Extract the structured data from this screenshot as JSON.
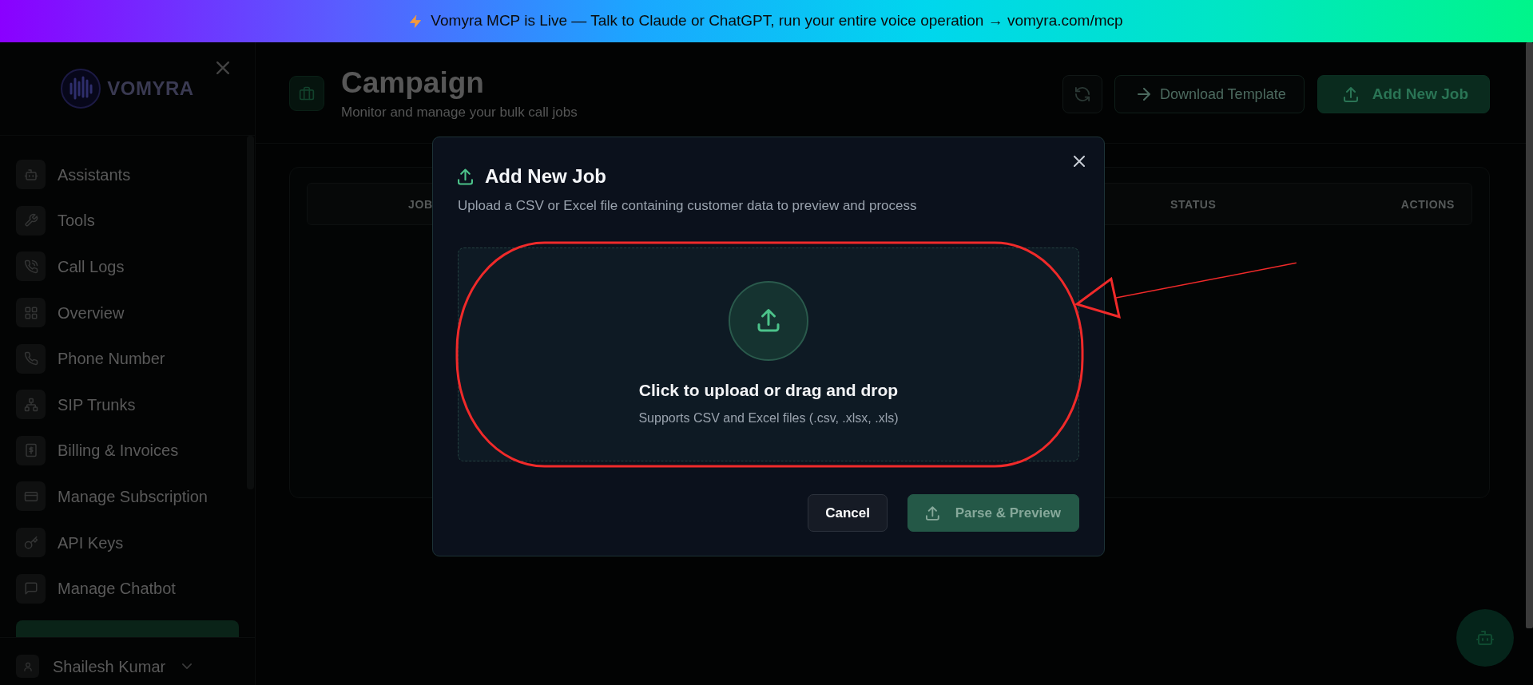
{
  "banner": {
    "text": "Vomyra MCP is Live — Talk to Claude or ChatGPT, run your entire voice operation → vomyra.com/mcp"
  },
  "sidebar": {
    "logo": "VOMYRA",
    "items": [
      {
        "label": "Assistants"
      },
      {
        "label": "Tools"
      },
      {
        "label": "Call Logs"
      },
      {
        "label": "Overview"
      },
      {
        "label": "Phone Number"
      },
      {
        "label": "SIP Trunks"
      },
      {
        "label": "Billing & Invoices"
      },
      {
        "label": "Manage Subscription"
      },
      {
        "label": "API Keys"
      },
      {
        "label": "Manage Chatbot"
      }
    ],
    "user": "Shailesh Kumar"
  },
  "page": {
    "title": "Campaign",
    "subtitle": "Monitor and manage your bulk call jobs",
    "buttons": [
      {
        "label": "Download Template",
        "kind": "outline"
      },
      {
        "label": "Add New Job",
        "kind": "primary"
      }
    ]
  },
  "table": {
    "columns": [
      "JOB",
      "STATUS",
      "ACTIONS"
    ]
  },
  "modal": {
    "title": "Add New Job",
    "subtitle": "Upload a CSV or Excel file containing customer data to preview and process",
    "dropzone": {
      "title": "Click to upload or drag and drop",
      "hint": "Supports CSV and Excel files (.csv, .xlsx, .xls)"
    },
    "buttons": [
      {
        "label": "Cancel",
        "kind": "secondary",
        "disabled": false
      },
      {
        "label": "Parse & Preview",
        "kind": "primary",
        "disabled": true
      }
    ]
  },
  "annotations": [
    {
      "kind": "ellipse"
    },
    {
      "kind": "arrow"
    }
  ]
}
